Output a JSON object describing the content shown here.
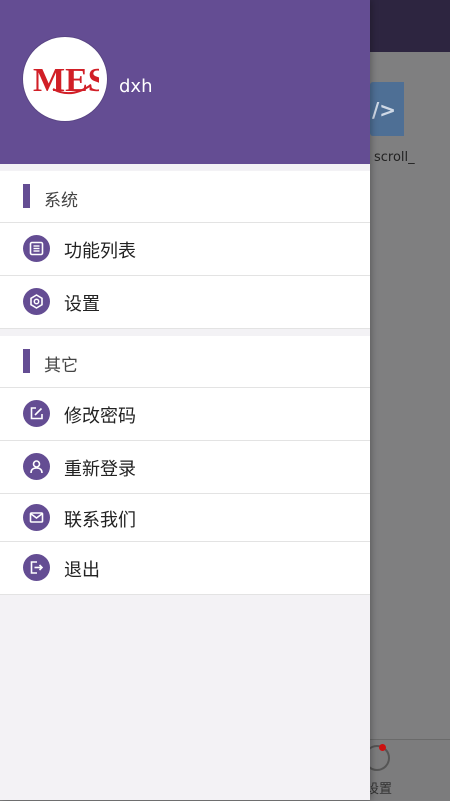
{
  "background": {
    "tile_label": "scroll_",
    "tab_label": "设置"
  },
  "drawer": {
    "avatar_logo": "MES",
    "username": "dxh",
    "sections": [
      {
        "title": "系统",
        "items": [
          {
            "label": "功能列表",
            "icon": "list-icon"
          },
          {
            "label": "设置",
            "icon": "settings-icon"
          }
        ]
      },
      {
        "title": "其它",
        "items": [
          {
            "label": "修改密码",
            "icon": "edit-icon"
          },
          {
            "label": "重新登录",
            "icon": "user-icon"
          },
          {
            "label": "联系我们",
            "icon": "mail-icon"
          },
          {
            "label": "退出",
            "icon": "logout-icon"
          }
        ]
      }
    ]
  },
  "colors": {
    "primary": "#644d93",
    "scrim": "#7f7f80"
  }
}
